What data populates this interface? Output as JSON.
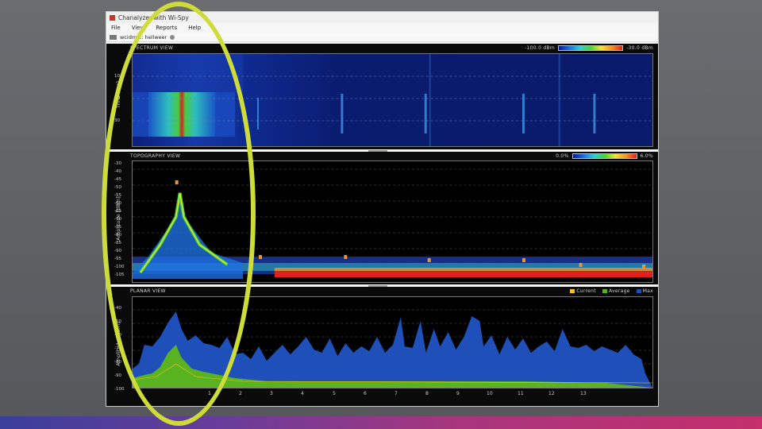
{
  "window": {
    "title": "Chanalyzer with Wi-Spy"
  },
  "menu": [
    "File",
    "View",
    "Reports",
    "Help"
  ],
  "address_bar": {
    "text": "wcidm 2: hellweer"
  },
  "spectrum_view": {
    "label": "SPECTRUM VIEW",
    "scale_min": "-100.0 dBm",
    "scale_max": "-30.0 dBm",
    "y_axis_label": "Time (sec)",
    "y_ticks": [
      "10",
      "60",
      "30"
    ]
  },
  "topography_view": {
    "label": "TOPOGRAPHY VIEW",
    "scale_min": "0.0%",
    "scale_max": "6.0%",
    "y_axis_label": "Amplitude [dBm]",
    "y_ticks": [
      "-30",
      "-40",
      "-45",
      "-50",
      "-55",
      "-60",
      "-65",
      "-70",
      "-75",
      "-80",
      "-85",
      "-90",
      "-95",
      "-100",
      "-105"
    ]
  },
  "planar_view": {
    "label": "PLANAR VIEW",
    "legend": [
      {
        "name": "Current",
        "color": "#f5c518"
      },
      {
        "name": "Average",
        "color": "#59b320"
      },
      {
        "name": "Max",
        "color": "#1f4fb8"
      }
    ],
    "y_axis_label": "Amplitude [dBm]",
    "y_ticks": [
      "-40",
      "-50",
      "-60",
      "-70",
      "-80",
      "-90",
      "-100"
    ],
    "x_ticks": [
      "1",
      "2",
      "3",
      "4",
      "5",
      "6",
      "7",
      "8",
      "9",
      "10",
      "11",
      "12",
      "13"
    ]
  },
  "colors": {
    "highlight": "#cddc39",
    "background": "#0a0a0a"
  }
}
